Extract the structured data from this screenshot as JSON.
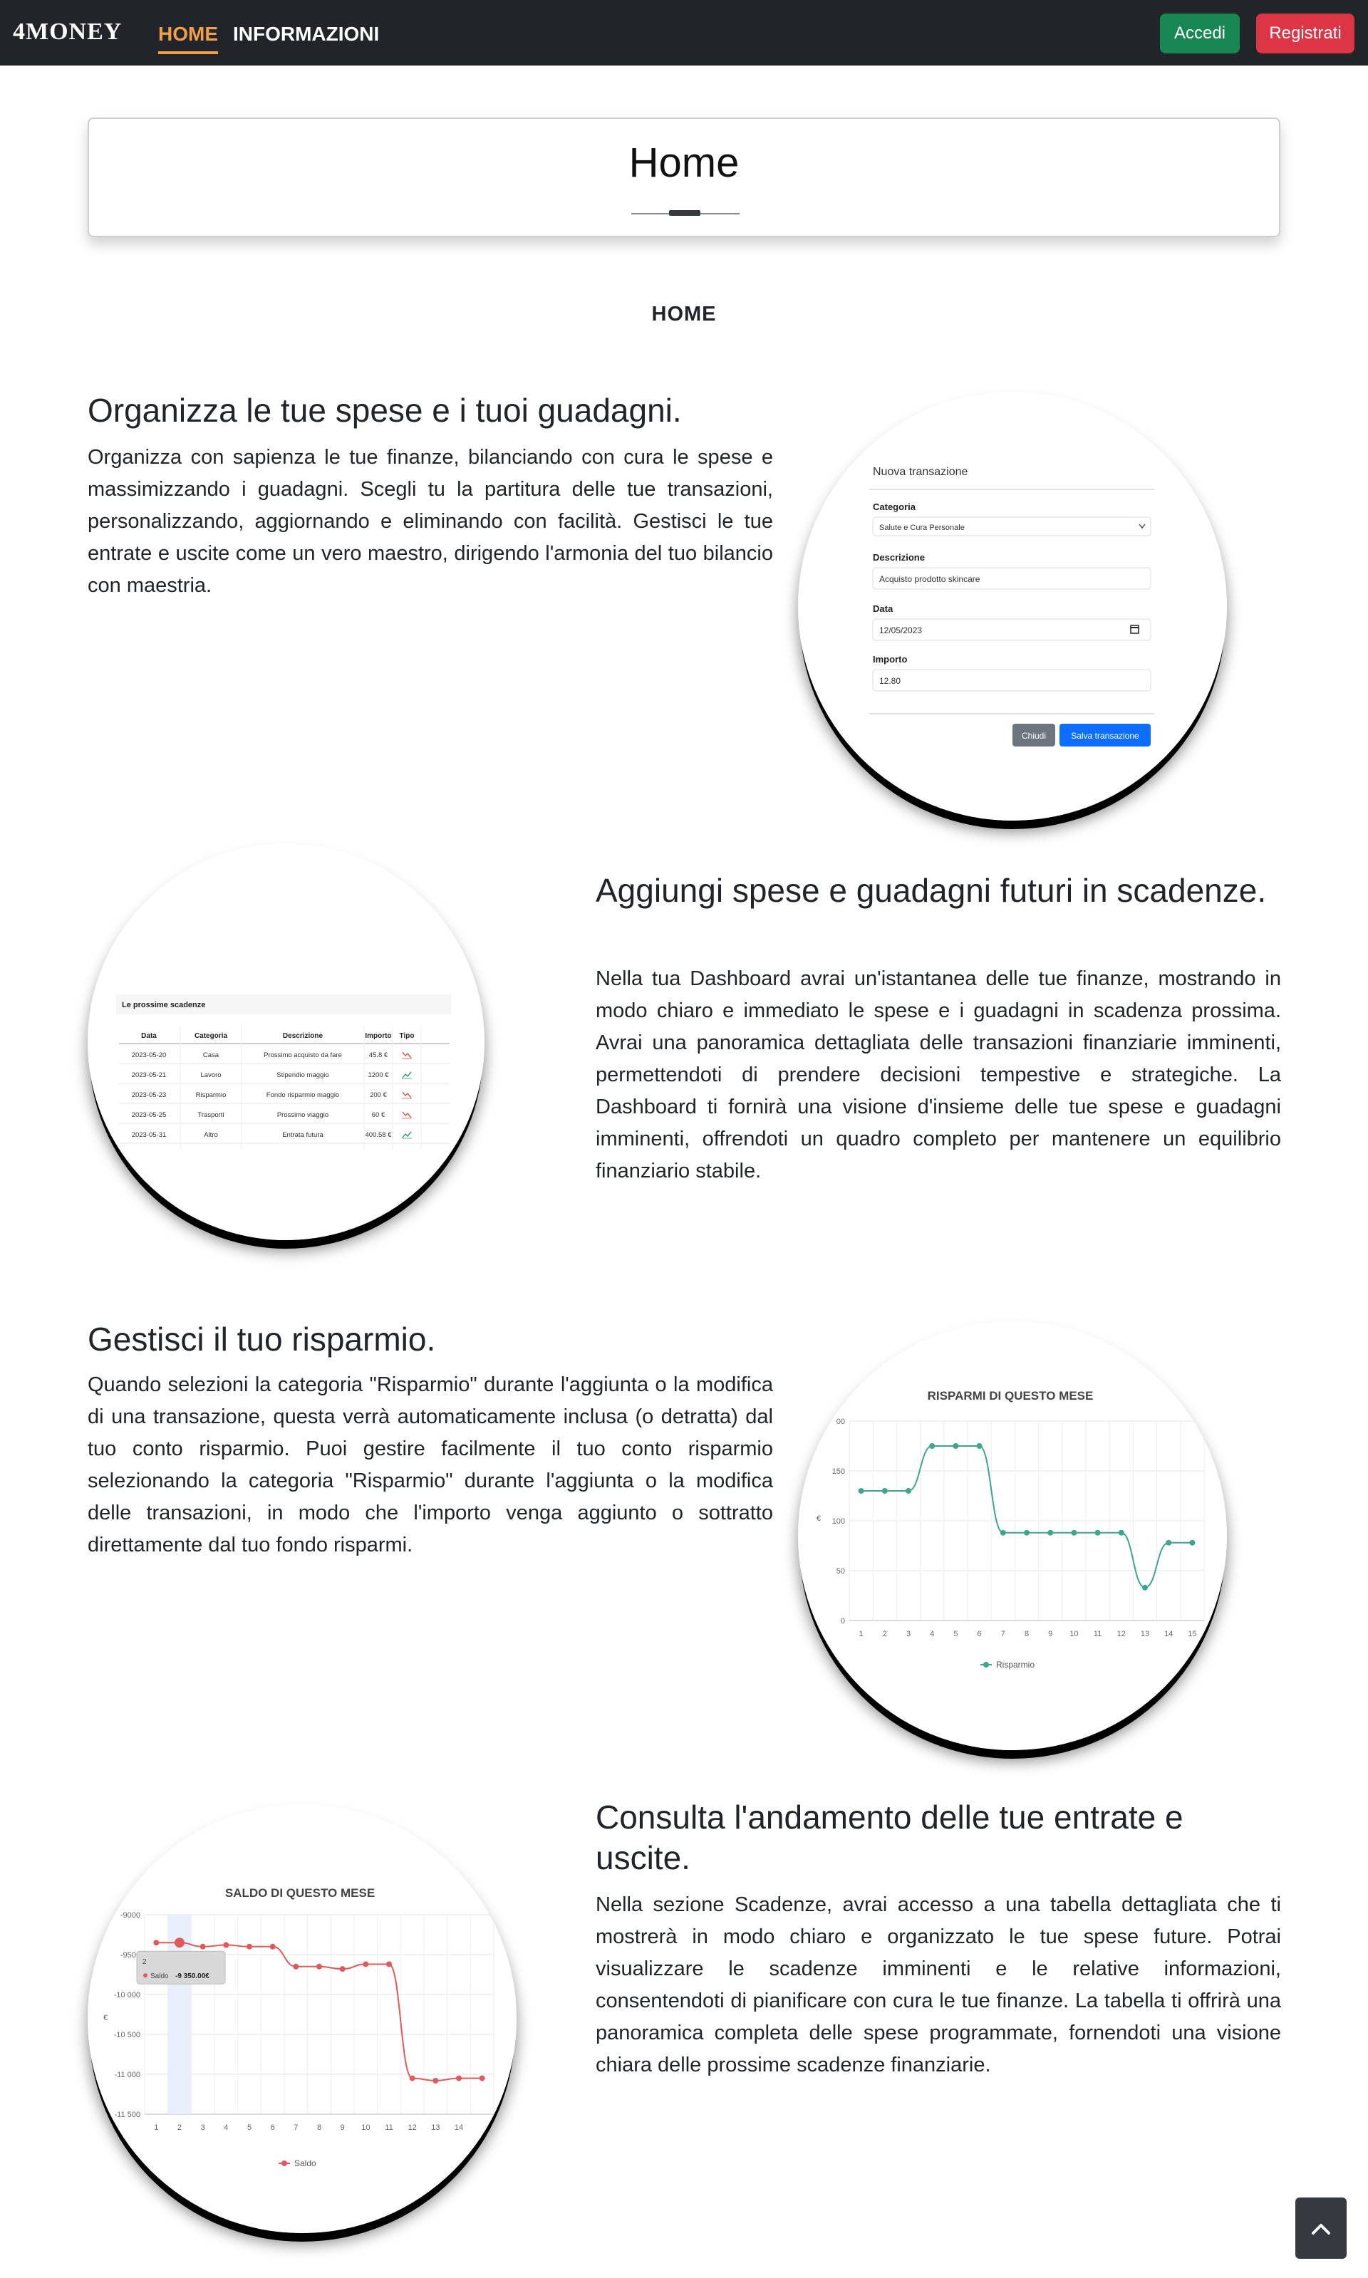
{
  "navbar": {
    "brand": "4MONEY",
    "links": [
      {
        "label": "HOME",
        "active": true
      },
      {
        "label": "INFORMAZIONI",
        "active": false
      }
    ],
    "login_label": "Accedi",
    "register_label": "Registrati"
  },
  "colors": {
    "navbar_bg": "#212529",
    "active_link": "#f0a04b",
    "login_bg": "#198754",
    "register_bg": "#dc3545",
    "primary_button": "#0d6efd",
    "savings_line": "#3fa58c",
    "balance_line": "#e05a5a"
  },
  "header": {
    "title": "Home"
  },
  "section_label": "HOME",
  "features": [
    {
      "title": "Organizza le tue spese e i tuoi guadagni.",
      "text": "Organizza con sapienza le tue finanze, bilanciando con cura le spese e massimizzando i guadagni. Scegli tu la partitura delle tue transazioni, personalizzando, aggiornando e eliminando con facilità. Gestisci le tue entrate e uscite come un vero maestro, dirigendo l'armonia del tuo bilancio con maestria."
    },
    {
      "title": "Aggiungi spese e guadagni futuri in scadenze.",
      "text": "Nella tua Dashboard avrai un'istantanea delle tue finanze, mostrando in modo chiaro e immediato le spese e i guadagni in scadenza prossima. Avrai una panoramica dettagliata delle transazioni finanziarie imminenti, permettendoti di prendere decisioni tempestive e strategiche. La Dashboard ti fornirà una visione d'insieme delle tue spese e guadagni imminenti, offrendoti un quadro completo per mantenere un equilibrio finanziario stabile."
    },
    {
      "title": "Gestisci il tuo risparmio.",
      "text": "Quando selezioni la categoria \"Risparmio\" durante l'aggiunta o la modifica di una transazione, questa verrà automaticamente inclusa (o detratta) dal tuo conto risparmio. Puoi gestire facilmente il tuo conto risparmio selezionando la categoria \"Risparmio\" durante l'aggiunta o la modifica delle transazioni, in modo che l'importo venga aggiunto o sottratto direttamente dal tuo fondo risparmi."
    },
    {
      "title": "Consulta l'andamento delle tue entrate e uscite.",
      "text": "Nella sezione Scadenze, avrai accesso a una tabella dettagliata che ti mostrerà in modo chiaro e organizzato le tue spese future. Potrai visualizzare le scadenze imminenti e le relative informazioni, consentendoti di pianificare con cura le tue finanze. La tabella ti offrirà una panoramica completa delle spese programmate, fornendoti una visione chiara delle prossime scadenze finanziarie."
    }
  ],
  "form_preview": {
    "title": "Nuova transazione",
    "category_label": "Categoria",
    "category_value": "Salute e Cura Personale",
    "description_label": "Descrizione",
    "description_value": "Acquisto prodotto skincare",
    "date_label": "Data",
    "date_value": "12/05/2023",
    "amount_label": "Importo",
    "amount_value": "12.80",
    "close_label": "Chiudi",
    "save_label": "Salva transazione"
  },
  "deadlines_preview": {
    "title": "Le prossime scadenze",
    "columns": [
      "Data",
      "Categoria",
      "Descrizione",
      "Importo",
      "Tipo"
    ],
    "rows": [
      {
        "data": "2023-05-20",
        "categoria": "Casa",
        "descrizione": "Prossimo acquisto da fare",
        "importo": "45.8 €",
        "tipo": "uscita"
      },
      {
        "data": "2023-05-21",
        "categoria": "Lavoro",
        "descrizione": "Stipendio maggio",
        "importo": "1200 €",
        "tipo": "entrata"
      },
      {
        "data": "2023-05-23",
        "categoria": "Risparmio",
        "descrizione": "Fondo risparmio maggio",
        "importo": "200 €",
        "tipo": "uscita"
      },
      {
        "data": "2023-05-25",
        "categoria": "Trasporti",
        "descrizione": "Prossimo viaggio",
        "importo": "60 €",
        "tipo": "uscita"
      },
      {
        "data": "2023-05-31",
        "categoria": "Altro",
        "descrizione": "Entrata futura",
        "importo": "400.58 €",
        "tipo": "entrata"
      }
    ]
  },
  "chart_data": [
    {
      "type": "line",
      "title": "RISPARMI DI QUESTO MESE",
      "ylabel": "€",
      "x": [
        1,
        2,
        3,
        4,
        5,
        6,
        7,
        8,
        9,
        10,
        11,
        12,
        13,
        14,
        15
      ],
      "x_tick_labels": [
        "1",
        "2",
        "3",
        "4",
        "5",
        "6",
        "7",
        "8",
        "9",
        "10",
        "11",
        "12",
        "13",
        "14",
        "15"
      ],
      "series": [
        {
          "name": "Risparmio",
          "values": [
            130,
            130,
            130,
            175,
            175,
            175,
            88,
            88,
            88,
            88,
            88,
            88,
            33,
            78,
            78
          ]
        }
      ],
      "ylim": [
        0,
        200
      ],
      "y_ticks": [
        0,
        50,
        100,
        150,
        200
      ],
      "y_tick_labels": [
        "0",
        "50",
        "100",
        "150",
        "00"
      ],
      "legend": "bottom",
      "grid": true
    },
    {
      "type": "line",
      "title": "SALDO DI QUESTO MESE",
      "ylabel": "€",
      "x": [
        1,
        2,
        3,
        4,
        5,
        6,
        7,
        8,
        9,
        10,
        11,
        12,
        13,
        14,
        15
      ],
      "x_tick_labels": [
        "1",
        "2",
        "3",
        "4",
        "5",
        "6",
        "7",
        "8",
        "9",
        "10",
        "11",
        "12",
        "13",
        "14"
      ],
      "series": [
        {
          "name": "Saldo",
          "values": [
            -9350,
            -9350,
            -9400,
            -9380,
            -9400,
            -9400,
            -9650,
            -9650,
            -9680,
            -9620,
            -9620,
            -11050,
            -11080,
            -11050,
            -11050
          ]
        }
      ],
      "ylim": [
        -11500,
        -9000
      ],
      "y_ticks": [
        -9000,
        -9500,
        -10000,
        -10500,
        -11000,
        -11500
      ],
      "y_tick_labels": [
        "-9000",
        "-9500",
        "-10 000",
        "-10 500",
        "-11 000",
        "-11 500"
      ],
      "legend": "bottom",
      "grid": true,
      "tooltip": {
        "x_label": "2",
        "series": "Saldo",
        "value": "-9 350.00€",
        "index": 1
      }
    }
  ]
}
